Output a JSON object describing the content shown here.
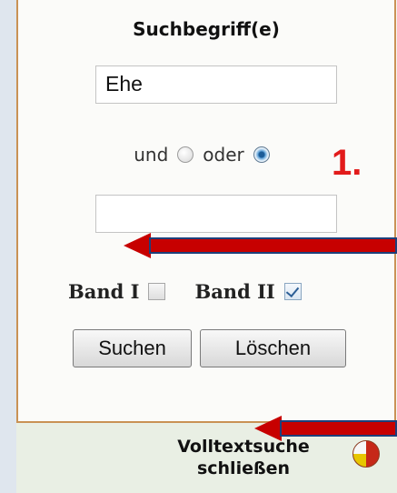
{
  "panel": {
    "title": "Suchbegriff(e)",
    "search_value_1": "Ehe",
    "search_value_2": "",
    "operator": {
      "and_label": "und",
      "or_label": "oder",
      "selected": "oder"
    },
    "volumes": [
      {
        "label": "Band I",
        "checked": false
      },
      {
        "label": "Band II",
        "checked": true
      }
    ],
    "buttons": {
      "search": "Suchen",
      "clear": "Löschen"
    }
  },
  "annotation": {
    "number": "1."
  },
  "footer": {
    "line1": "Volltextsuche",
    "line2": "schließen"
  },
  "colors": {
    "panel_border": "#c99255",
    "footer_bg": "#e9efe4",
    "arrow": "#c70000",
    "annotation_text": "#e21b1b"
  },
  "icons": {
    "close_fulltext": "pie-chart-icon"
  }
}
